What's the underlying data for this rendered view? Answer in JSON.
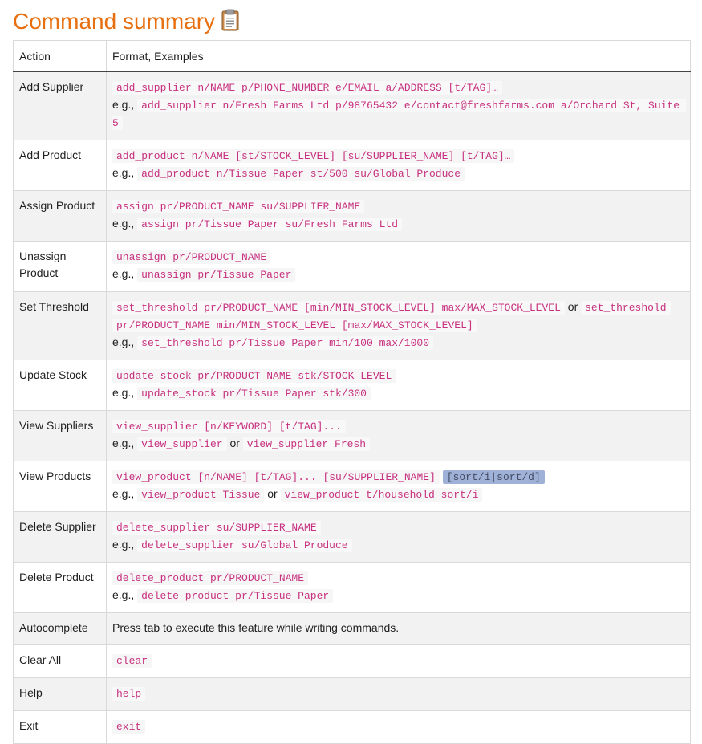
{
  "page": {
    "title": "Command summary",
    "icon": "clipboard-icon"
  },
  "table": {
    "headers": [
      "Action",
      "Format, Examples"
    ],
    "eg": "e.g.,",
    "or": "or",
    "rows": {
      "add_supplier": {
        "action": "Add Supplier",
        "format": "add_supplier n/NAME p/PHONE_NUMBER e/EMAIL a/ADDRESS [t/TAG]…",
        "example": "add_supplier n/Fresh Farms Ltd p/98765432 e/contact@freshfarms.com a/Orchard St, Suite 5"
      },
      "add_product": {
        "action": "Add Product",
        "format": "add_product n/NAME [st/STOCK_LEVEL] [su/SUPPLIER_NAME] [t/TAG]…",
        "example": "add_product n/Tissue Paper st/500 su/Global Produce"
      },
      "assign_product": {
        "action": "Assign Product",
        "format": "assign pr/PRODUCT_NAME su/SUPPLIER_NAME",
        "example": "assign pr/Tissue Paper su/Fresh Farms Ltd"
      },
      "unassign_product": {
        "action": "Unassign Product",
        "format": "unassign pr/PRODUCT_NAME",
        "example": "unassign pr/Tissue Paper"
      },
      "set_threshold": {
        "action": "Set Threshold",
        "format_a": "set_threshold pr/PRODUCT_NAME [min/MIN_STOCK_LEVEL] max/MAX_STOCK_LEVEL",
        "format_b_start": "set_threshold",
        "format_b_rest": "pr/PRODUCT_NAME min/MIN_STOCK_LEVEL [max/MAX_STOCK_LEVEL]",
        "example": "set_threshold pr/Tissue Paper min/100 max/1000"
      },
      "update_stock": {
        "action": "Update Stock",
        "format": "update_stock pr/PRODUCT_NAME stk/STOCK_LEVEL",
        "example": "update_stock pr/Tissue Paper stk/300"
      },
      "view_suppliers": {
        "action": "View Suppliers",
        "format": "view_supplier [n/KEYWORD] [t/TAG]...",
        "example_a": "view_supplier",
        "example_b": "view_supplier Fresh"
      },
      "view_products": {
        "action": "View Products",
        "format": "view_product [n/NAME] [t/TAG]... [su/SUPPLIER_NAME]",
        "format_highlight": "[sort/i|sort/d]",
        "example_a": "view_product Tissue",
        "example_b": "view_product t/household sort/i"
      },
      "delete_supplier": {
        "action": "Delete Supplier",
        "format": "delete_supplier su/SUPPLIER_NAME",
        "example": "delete_supplier su/Global Produce"
      },
      "delete_product": {
        "action": "Delete Product",
        "format": "delete_product pr/PRODUCT_NAME",
        "example": "delete_product pr/Tissue Paper"
      },
      "autocomplete": {
        "action": "Autocomplete",
        "description": "Press tab to execute this feature while writing commands."
      },
      "clear_all": {
        "action": "Clear All",
        "format": "clear"
      },
      "help": {
        "action": "Help",
        "format": "help"
      },
      "exit": {
        "action": "Exit",
        "format": "exit"
      }
    }
  },
  "colors": {
    "title": "#e76f0f",
    "code_text": "#c7317f",
    "stripe": "#f2f2f2",
    "highlight": "#9fb1d6"
  }
}
